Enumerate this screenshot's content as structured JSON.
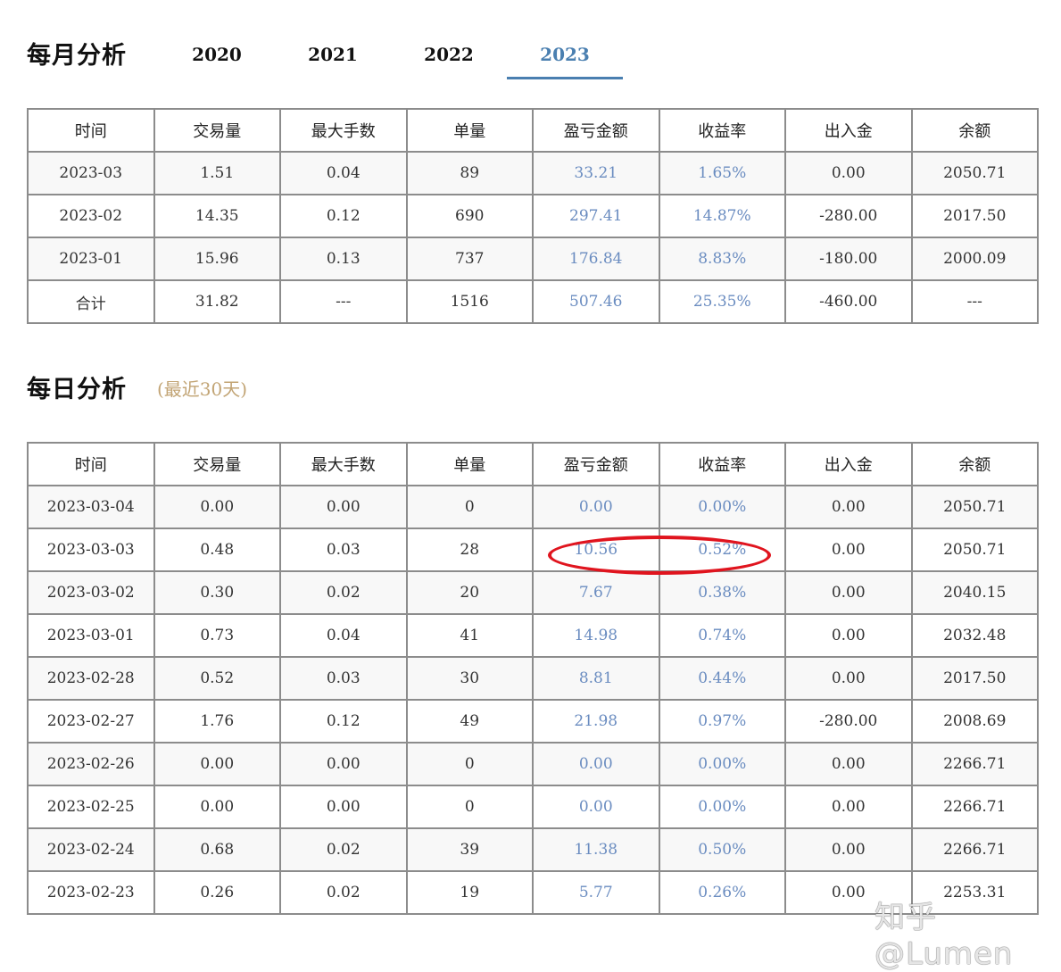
{
  "monthly": {
    "title": "每月分析",
    "tabs": [
      {
        "label": "2020",
        "active": false
      },
      {
        "label": "2021",
        "active": false
      },
      {
        "label": "2022",
        "active": false
      },
      {
        "label": "2023",
        "active": true
      }
    ],
    "headers": [
      "时间",
      "交易量",
      "最大手数",
      "单量",
      "盈亏金额",
      "收益率",
      "出入金",
      "余额"
    ],
    "rows": [
      [
        "2023-03",
        "1.51",
        "0.04",
        "89",
        "33.21",
        "1.65%",
        "0.00",
        "2050.71"
      ],
      [
        "2023-02",
        "14.35",
        "0.12",
        "690",
        "297.41",
        "14.87%",
        "-280.00",
        "2017.50"
      ],
      [
        "2023-01",
        "15.96",
        "0.13",
        "737",
        "176.84",
        "8.83%",
        "-180.00",
        "2000.09"
      ],
      [
        "合计",
        "31.82",
        "---",
        "1516",
        "507.46",
        "25.35%",
        "-460.00",
        "---"
      ]
    ]
  },
  "daily": {
    "title": "每日分析",
    "subtitle": "(最近30天)",
    "headers": [
      "时间",
      "交易量",
      "最大手数",
      "单量",
      "盈亏金额",
      "收益率",
      "出入金",
      "余额"
    ],
    "rows": [
      [
        "2023-03-04",
        "0.00",
        "0.00",
        "0",
        "0.00",
        "0.00%",
        "0.00",
        "2050.71"
      ],
      [
        "2023-03-03",
        "0.48",
        "0.03",
        "28",
        "10.56",
        "0.52%",
        "0.00",
        "2050.71"
      ],
      [
        "2023-03-02",
        "0.30",
        "0.02",
        "20",
        "7.67",
        "0.38%",
        "0.00",
        "2040.15"
      ],
      [
        "2023-03-01",
        "0.73",
        "0.04",
        "41",
        "14.98",
        "0.74%",
        "0.00",
        "2032.48"
      ],
      [
        "2023-02-28",
        "0.52",
        "0.03",
        "30",
        "8.81",
        "0.44%",
        "0.00",
        "2017.50"
      ],
      [
        "2023-02-27",
        "1.76",
        "0.12",
        "49",
        "21.98",
        "0.97%",
        "-280.00",
        "2008.69"
      ],
      [
        "2023-02-26",
        "0.00",
        "0.00",
        "0",
        "0.00",
        "0.00%",
        "0.00",
        "2266.71"
      ],
      [
        "2023-02-25",
        "0.00",
        "0.00",
        "0",
        "0.00",
        "0.00%",
        "0.00",
        "2266.71"
      ],
      [
        "2023-02-24",
        "0.68",
        "0.02",
        "39",
        "11.38",
        "0.50%",
        "0.00",
        "2266.71"
      ],
      [
        "2023-02-23",
        "0.26",
        "0.02",
        "19",
        "5.77",
        "0.26%",
        "0.00",
        "2253.31"
      ]
    ]
  },
  "watermark": "知乎 @Lumen",
  "colors": {
    "accent": "#4a7fb0",
    "value_blue": "#6a8cc0",
    "highlight": "#e0141e",
    "subtitle": "#c2a474"
  }
}
